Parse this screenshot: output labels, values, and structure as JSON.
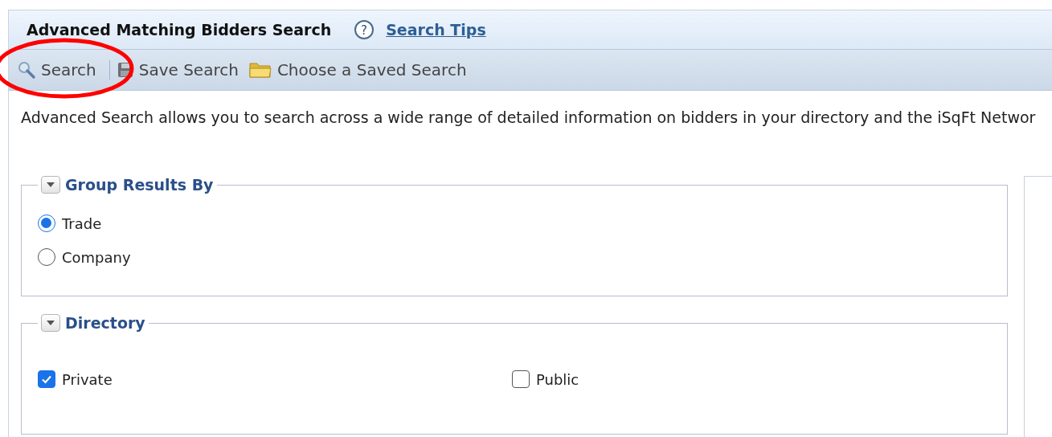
{
  "header": {
    "title": "Advanced Matching Bidders Search",
    "help_icon": "?",
    "help_link": "Search Tips"
  },
  "toolbar": [
    {
      "kind": "search",
      "label": "Search"
    },
    {
      "kind": "save",
      "label": "Save Search"
    },
    {
      "kind": "folder",
      "label": "Choose a Saved Search"
    }
  ],
  "annotations": [
    {
      "kind": "ellipse"
    }
  ],
  "description": "Advanced Search allows you to search across a wide range of detailed information on bidders in your directory and the iSqFt Networ",
  "sections": [
    {
      "title": "Group Results By",
      "kind": "radio",
      "options": [
        {
          "label": "Trade",
          "selected": true
        },
        {
          "label": "Company",
          "selected": false
        }
      ]
    },
    {
      "title": "Directory",
      "kind": "checkbox",
      "options": [
        {
          "label": "Private",
          "checked": true
        },
        {
          "label": "Public",
          "checked": false
        }
      ]
    }
  ]
}
